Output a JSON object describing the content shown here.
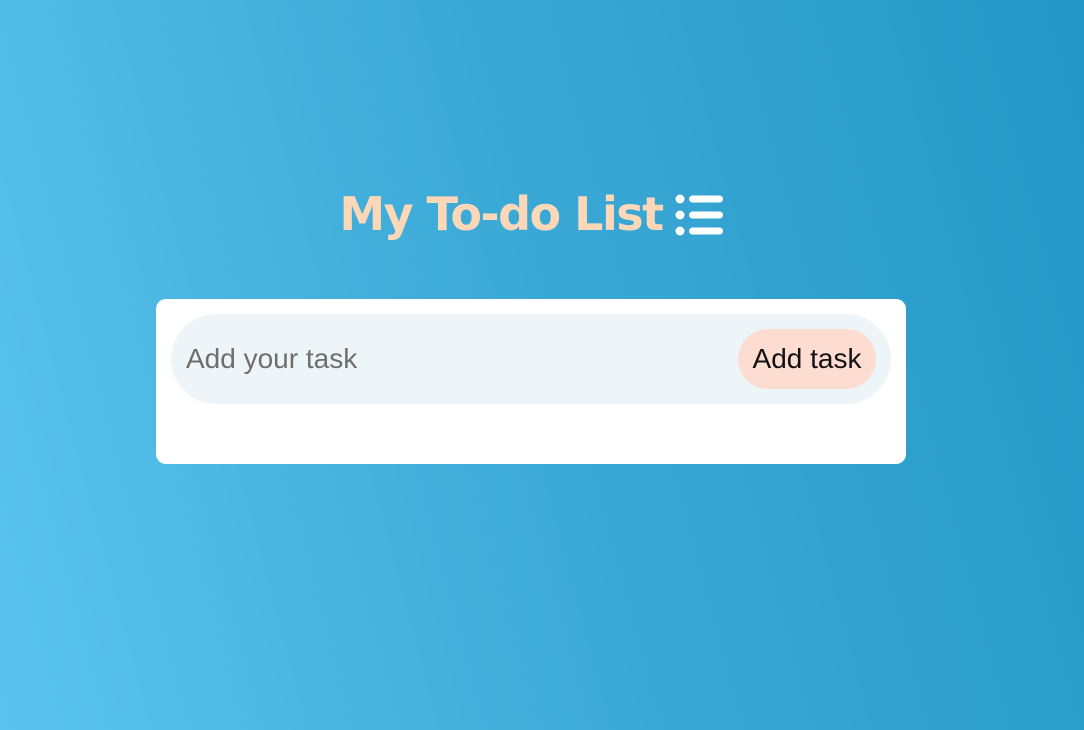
{
  "header": {
    "title": "My To-do List",
    "icon": "list-icon"
  },
  "task_form": {
    "input_value": "",
    "input_placeholder": "Add your task",
    "add_button_label": "Add task"
  },
  "tasks": [],
  "colors": {
    "title": "#fcd7b8",
    "background_start": "#5ac4ee",
    "background_end": "#2398c6",
    "card": "#ffffff",
    "input_row": "#edf5f8",
    "button": "#fddcd2"
  }
}
